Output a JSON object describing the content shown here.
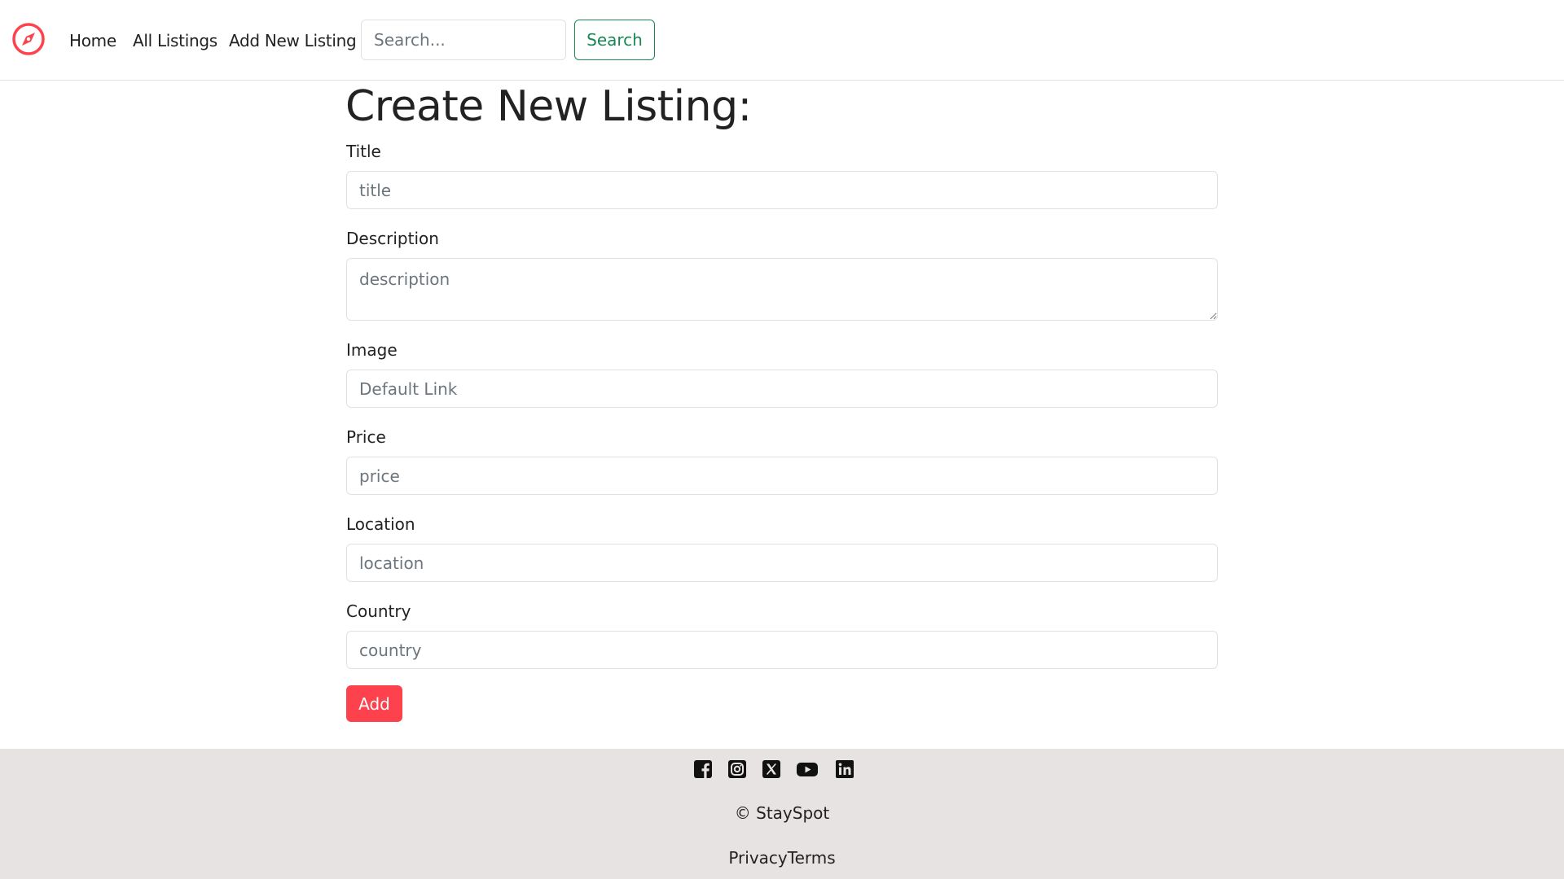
{
  "nav": {
    "brand_icon": "compass-icon",
    "brand_color": "#fe424d",
    "links": [
      "Home",
      "All Listings",
      "Add New Listing"
    ],
    "search": {
      "placeholder": "Search...",
      "value": "",
      "button_label": "Search"
    }
  },
  "form": {
    "heading": "Create New Listing:",
    "fields": {
      "title": {
        "label": "Title",
        "placeholder": "title",
        "value": ""
      },
      "description": {
        "label": "Description",
        "placeholder": "description",
        "value": ""
      },
      "image": {
        "label": "Image",
        "placeholder": "Default Link",
        "value": ""
      },
      "price": {
        "label": "Price",
        "placeholder": "price",
        "value": ""
      },
      "location": {
        "label": "Location",
        "placeholder": "location",
        "value": ""
      },
      "country": {
        "label": "Country",
        "placeholder": "country",
        "value": ""
      }
    },
    "submit_label": "Add",
    "submit_color": "#fe424d"
  },
  "footer": {
    "socials": [
      "facebook-icon",
      "instagram-icon",
      "x-twitter-icon",
      "youtube-icon",
      "linkedin-icon"
    ],
    "copyright": "© StaySpot",
    "links": [
      "Privacy",
      "Terms"
    ],
    "background": "#e7e3e2"
  }
}
